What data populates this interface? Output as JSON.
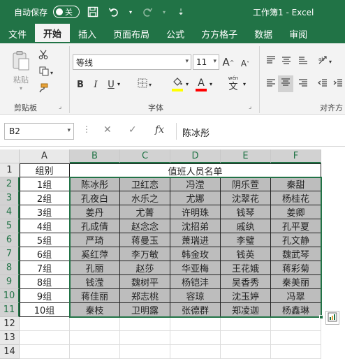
{
  "titlebar": {
    "autosave_label": "自动保存",
    "autosave_state": "关",
    "doc_title": "工作簿1 - Excel"
  },
  "tabs": [
    "文件",
    "开始",
    "插入",
    "页面布局",
    "公式",
    "方方格子",
    "数据",
    "审阅"
  ],
  "active_tab": "开始",
  "ribbon": {
    "paste_label": "粘贴",
    "clipboard_label": "剪贴板",
    "font_group_label": "字体",
    "align_group_label": "对齐方",
    "font_name": "等线",
    "font_size": "11",
    "bold": "B",
    "italic": "I",
    "underline": "U",
    "grow_font": "A",
    "shrink_font": "A",
    "font_color_letter": "A",
    "wen_label": "wén",
    "wen_char": "文"
  },
  "formula_bar": {
    "name_box": "B2",
    "fx": "fx",
    "value": "陈冰彤"
  },
  "columns": [
    "A",
    "B",
    "C",
    "D",
    "E",
    "F"
  ],
  "rows": [
    "1",
    "2",
    "3",
    "4",
    "5",
    "6",
    "7",
    "8",
    "9",
    "10",
    "11",
    "12",
    "13",
    "14"
  ],
  "sheet": {
    "a1": "组别",
    "header": "值班人员名单",
    "groups": [
      "1组",
      "2组",
      "3组",
      "4组",
      "5组",
      "6组",
      "7组",
      "8组",
      "9组",
      "10组"
    ],
    "names": [
      [
        "陈冰彤",
        "卫红恋",
        "冯滢",
        "阴乐萱",
        "秦甜"
      ],
      [
        "孔夜白",
        "水乐之",
        "尤娜",
        "沈翠花",
        "杨桂花"
      ],
      [
        "姜丹",
        "尤菁",
        "许明珠",
        "钱琴",
        "姜卿"
      ],
      [
        "孔成倩",
        "赵念念",
        "沈招弟",
        "戚纨",
        "孔平夏"
      ],
      [
        "严琦",
        "蒋曼玉",
        "萧瑞进",
        "李璧",
        "孔文静"
      ],
      [
        "奚红萍",
        "李万敏",
        "韩金玫",
        "钱英",
        "魏武琴"
      ],
      [
        "孔丽",
        "赵莎",
        "华亚梅",
        "王花娥",
        "蒋彩菊"
      ],
      [
        "钱滢",
        "魏树平",
        "杨铠沣",
        "吴香秀",
        "秦美丽"
      ],
      [
        "蒋佳丽",
        "郑志桃",
        "容琼",
        "沈玉婷",
        "冯翠"
      ],
      [
        "秦枝",
        "卫明露",
        "张德群",
        "郑凌迦",
        "杨鑫琳"
      ]
    ]
  },
  "colors": {
    "accent": "#217346",
    "shade": "#bdbdbd"
  }
}
